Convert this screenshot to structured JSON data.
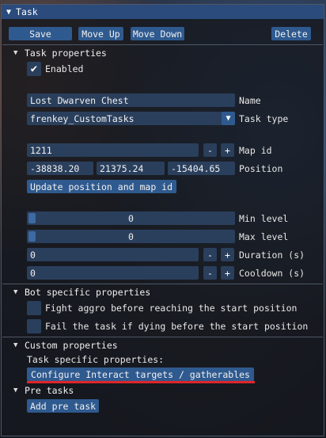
{
  "window": {
    "title": "Task"
  },
  "toolbar": {
    "save": "Save",
    "move_up": "Move Up",
    "move_down": "Move Down",
    "delete": "Delete"
  },
  "task_properties": {
    "header": "Task properties",
    "enabled_label": "Enabled",
    "enabled": true,
    "name_value": "Lost Dwarven Chest",
    "name_label": "Name",
    "task_type_value": "frenkey_CustomTasks",
    "task_type_label": "Task type",
    "map_id_value": "1211",
    "map_id_label": "Map id",
    "pos_x": "-38838.20",
    "pos_y": "21375.24",
    "pos_z": "-15404.65",
    "position_label": "Position",
    "update_button": "Update position and map id",
    "min_level_value": "0",
    "min_level_label": "Min level",
    "max_level_value": "0",
    "max_level_label": "Max level",
    "duration_value": "0",
    "duration_label": "Duration (s)",
    "cooldown_value": "0",
    "cooldown_label": "Cooldown (s)",
    "minus": "-",
    "plus": "+"
  },
  "bot_properties": {
    "header": "Bot specific properties",
    "fight_aggro": "Fight aggro before reaching the start position",
    "fail_dying": "Fail the task if dying before the start position"
  },
  "custom_properties": {
    "header": "Custom properties",
    "subtitle": "Task specific properties:",
    "configure_button": "Configure Interact targets / gatherables"
  },
  "pre_tasks": {
    "header": "Pre tasks",
    "add_button": "Add pre task"
  },
  "colors": {
    "accent": "#2f5a8f",
    "frame": "#2a3f5c",
    "highlight": "#e0252a",
    "titlebar": "#2a4b7c"
  }
}
